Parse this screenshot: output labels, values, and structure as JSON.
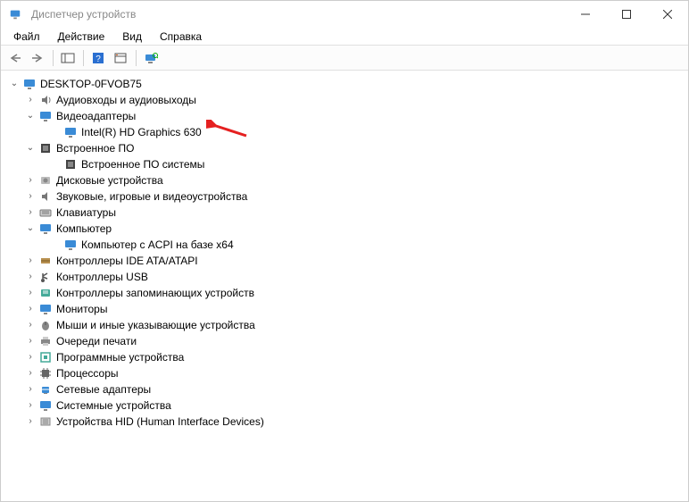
{
  "window": {
    "title": "Диспетчер устройств"
  },
  "menu": {
    "file": "Файл",
    "action": "Действие",
    "view": "Вид",
    "help": "Справка"
  },
  "tree": {
    "root": "DESKTOP-0FVOB75",
    "audio": "Аудиовходы и аудиовыходы",
    "video": "Видеоадаптеры",
    "video_child": "Intel(R) HD Graphics 630",
    "firmware": "Встроенное ПО",
    "firmware_child": "Встроенное ПО системы",
    "disk": "Дисковые устройства",
    "sound": "Звуковые, игровые и видеоустройства",
    "keyboard": "Клавиатуры",
    "computer": "Компьютер",
    "computer_child": "Компьютер с ACPI на базе x64",
    "ide": "Контроллеры IDE ATA/ATAPI",
    "usb": "Контроллеры USB",
    "storage": "Контроллеры запоминающих устройств",
    "monitor": "Мониторы",
    "mouse": "Мыши и иные указывающие устройства",
    "print": "Очереди печати",
    "software": "Программные устройства",
    "cpu": "Процессоры",
    "network": "Сетевые адаптеры",
    "system": "Системные устройства",
    "hid": "Устройства HID (Human Interface Devices)"
  }
}
